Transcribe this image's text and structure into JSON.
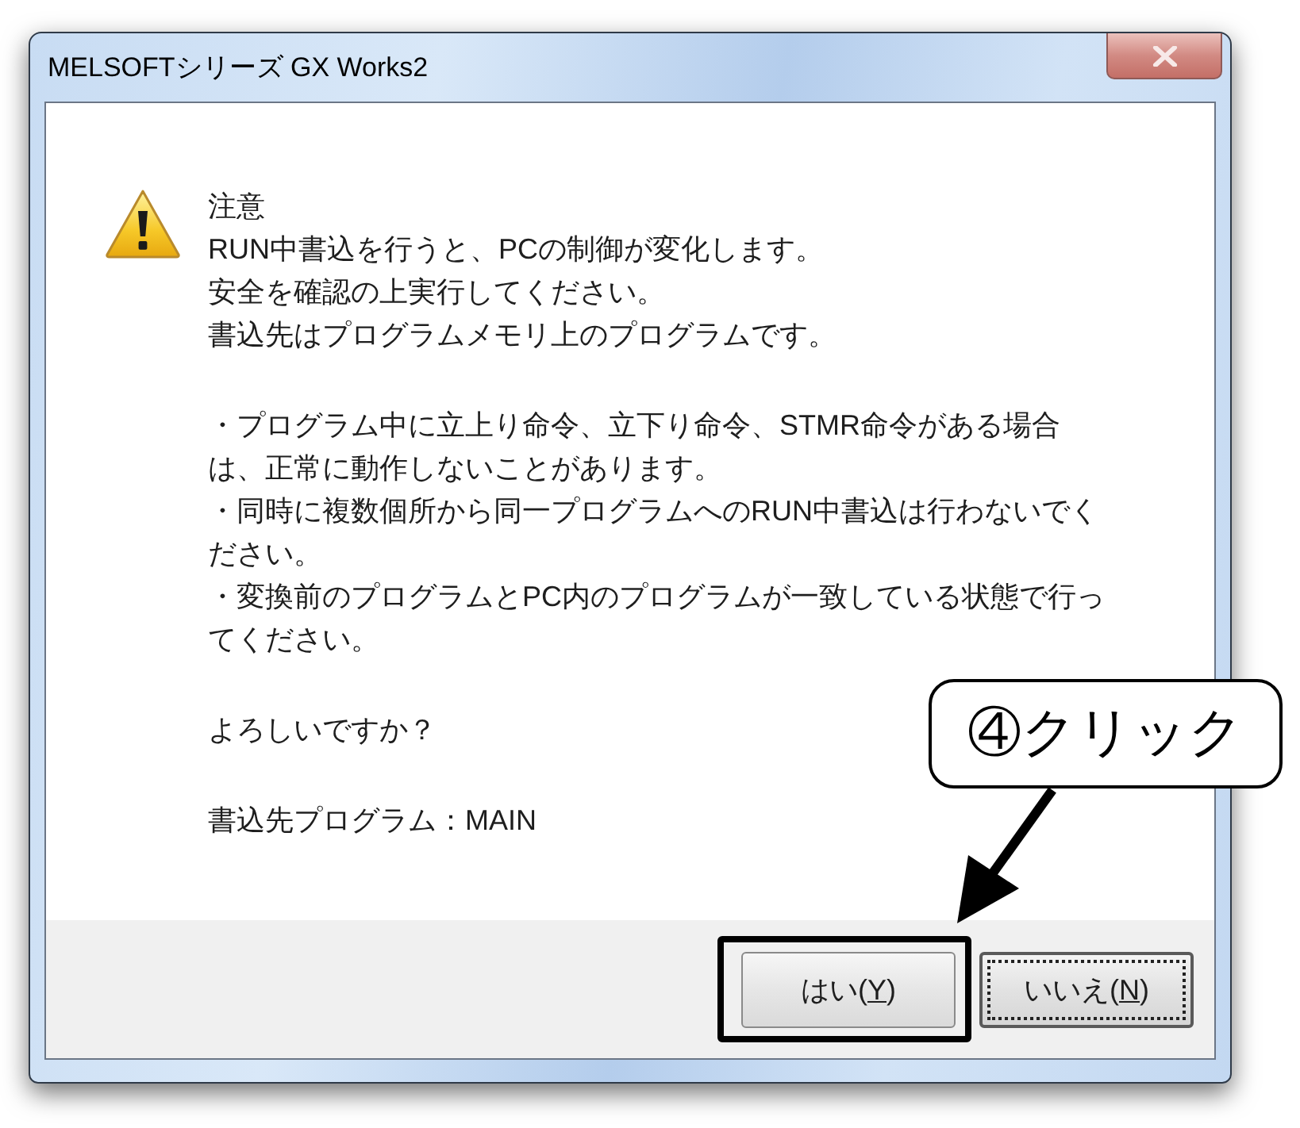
{
  "window": {
    "title": "MELSOFTシリーズ GX Works2"
  },
  "message": {
    "heading": "注意",
    "sections": [
      [
        [
          "RUN中書込を行うと、PCの制御が変化します。"
        ],
        [
          "安全を確認の上実行してください。"
        ],
        [
          "書込先はプログラムメモリ上のプログラムです。"
        ]
      ],
      [
        [
          "・プログラム中に立上り命令、立下り命令、STMR命令がある場合",
          "は、正常に動作しないことがあります。"
        ],
        [
          "・同時に複数個所から同一プログラムへのRUN中書込は行わないでく",
          "ださい。"
        ],
        [
          "・変換前のプログラムとPC内のプログラムが一致している状態で行っ",
          "てください。"
        ]
      ],
      [
        [
          "よろしいですか？"
        ]
      ],
      [
        [
          "書込先プログラム：MAIN"
        ]
      ]
    ]
  },
  "buttons": [
    {
      "prefix": "はい(",
      "key": "Y",
      "suffix": ")",
      "focused": false,
      "highlighted": true
    },
    {
      "prefix": "いいえ(",
      "key": "N",
      "suffix": ")",
      "focused": true,
      "highlighted": false
    }
  ],
  "annotation": {
    "callout": "④クリック"
  }
}
